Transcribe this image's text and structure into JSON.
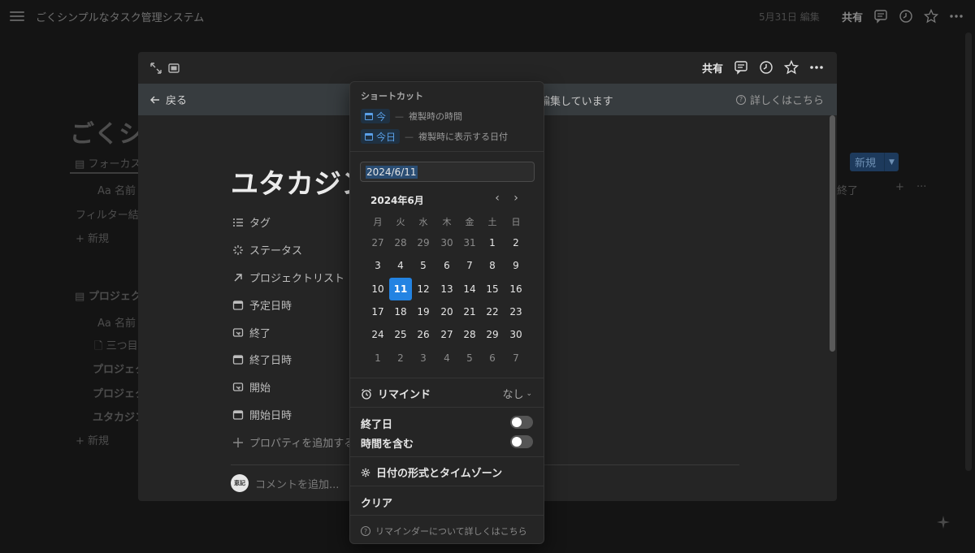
{
  "app": {
    "title": "ごくシンプルなタスク管理システム",
    "edited": "5月31日 編集",
    "share": "共有"
  },
  "background": {
    "page_title": "ごくシ",
    "tab_focus": "フォーカス",
    "col_name": "Aa 名前",
    "filter": "フィルター結",
    "new_row": "+ 新規",
    "section_project": "プロジェク",
    "col_name2": "Aa 名前",
    "item_1": "三つ目",
    "item_2": "プロジェク",
    "item_3": "プロジェク",
    "item_4": "ユタカジン",
    "new_row2": "+ 新規",
    "new_button": "新規",
    "col_end": "終了"
  },
  "modal": {
    "share": "共有",
    "back": "戻る",
    "bar_message": "編集しています",
    "bar_help": "詳しくはこちら",
    "page_title": "ユタカジン",
    "properties": [
      {
        "icon": "list-icon",
        "label": "タグ"
      },
      {
        "icon": "status-icon",
        "label": "ステータス"
      },
      {
        "icon": "relation-arrow-icon",
        "label": "プロジェクトリスト"
      },
      {
        "icon": "calendar-icon",
        "label": "予定日時"
      },
      {
        "icon": "rollup-icon",
        "label": "終了"
      },
      {
        "icon": "calendar-icon",
        "label": "終了日時"
      },
      {
        "icon": "rollup-icon",
        "label": "開始"
      },
      {
        "icon": "calendar-icon",
        "label": "開始日時"
      }
    ],
    "add_property": "プロパティを追加する",
    "comment_placeholder": "コメントを追加...",
    "avatar_text": "恵記"
  },
  "date_picker": {
    "shortcuts_label": "ショートカット",
    "shortcuts": [
      {
        "chip": "今",
        "description": "複製時の時間"
      },
      {
        "chip": "今日",
        "description": "複製時に表示する日付"
      }
    ],
    "shortcut_dash": "—",
    "input_value": "2024/6/11",
    "month_label": "2024年6月",
    "weekdays": [
      "月",
      "火",
      "水",
      "木",
      "金",
      "土",
      "日"
    ],
    "weeks": [
      [
        "27",
        "28",
        "29",
        "30",
        "31",
        "1",
        "2"
      ],
      [
        "3",
        "4",
        "5",
        "6",
        "7",
        "8",
        "9"
      ],
      [
        "10",
        "11",
        "12",
        "13",
        "14",
        "15",
        "16"
      ],
      [
        "17",
        "18",
        "19",
        "20",
        "21",
        "22",
        "23"
      ],
      [
        "24",
        "25",
        "26",
        "27",
        "28",
        "29",
        "30"
      ],
      [
        "1",
        "2",
        "3",
        "4",
        "5",
        "6",
        "7"
      ]
    ],
    "selected_day": "11",
    "remind_label": "リマインド",
    "remind_value": "なし",
    "end_date_label": "終了日",
    "end_date_enabled": false,
    "include_time_label": "時間を含む",
    "include_time_enabled": false,
    "format_label": "日付の形式とタイムゾーン",
    "clear_label": "クリア",
    "footer_help": "リマインダーについて詳しくはこちら"
  }
}
